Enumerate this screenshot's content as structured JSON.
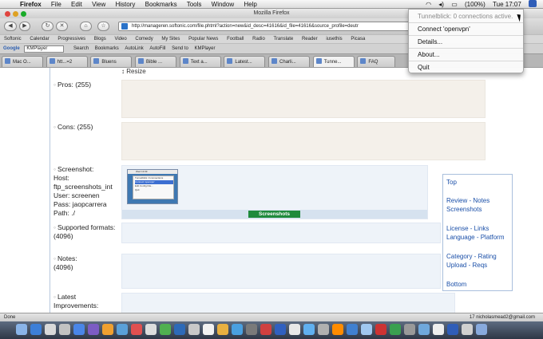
{
  "menubar": {
    "app": "Firefox",
    "menus": [
      "File",
      "Edit",
      "View",
      "History",
      "Bookmarks",
      "Tools",
      "Window",
      "Help"
    ],
    "battery": "(100%)",
    "clock": "Tue 17:07"
  },
  "window": {
    "title": "Mozilla Firefox",
    "url": "http://manageren.softonic.com/file.phtml?action=new&id_desc=41616&id_file=41616&source_profile=deutr"
  },
  "bookmarks": [
    "Softonic",
    "Calendar",
    "Progressives",
    "Blogs",
    "Video",
    "Comedy",
    "My Sites",
    "Popular News",
    "Football",
    "Radio",
    "Translate",
    "Reader",
    "iusethis",
    "Picasa"
  ],
  "googlebar": {
    "logo": "Google",
    "field": "KMPlayer",
    "items": [
      "Search",
      "Bookmarks",
      "AutoLink",
      "AutoFill",
      "Send to",
      "KMPlayer"
    ],
    "settings": "Settings"
  },
  "tabs": [
    "Mac O...",
    "htt...=2",
    "Bluens",
    "Bible ...",
    "Text a...",
    "Latest...",
    "Charli...",
    "Tunne...",
    "FAQ"
  ],
  "page": {
    "resize": "Resize",
    "pros": "Pros: (255)",
    "cons": "Cons: (255)",
    "screenshot_label": "Screenshot:",
    "host": "Host:",
    "host_value": "ftp_screenshots_int",
    "user": "User: screenen",
    "pass": "Pass: jaopcarrera",
    "path": "Path: ./",
    "screenshots_button": "Screenshots",
    "supported_formats": "Supported formats:",
    "supported_count": "(4096)",
    "notes": "Notes:",
    "notes_count": "(4096)",
    "latest": "Latest Improvements:",
    "thumb_clock": "Wed 13:09",
    "thumb_menu": [
      "Tunnelblick: 0 connections",
      "Connect 'openvpn'",
      "Edit Config File...",
      "Quit"
    ]
  },
  "nav_links": {
    "top": "Top",
    "review_notes": "Review - Notes",
    "screenshots": "Screenshots",
    "license_links": "License - Links",
    "language_platform": "Language - Platform",
    "category_rating": "Category - Rating",
    "upload_reqs": "Upload - Reqs",
    "bottom": "Bottom"
  },
  "status": {
    "text": "Done",
    "mail": "17 nicholasmead2@gmail.com"
  },
  "tunnelblick_menu": {
    "status": "Tunnelblick: 0 connections active.",
    "connect": "Connect 'openvpn'",
    "details": "Details...",
    "about": "About...",
    "quit": "Quit"
  },
  "dock_colors": [
    "#8ab4e8",
    "#3d7fd8",
    "#d9d9d9",
    "#c2c2c2",
    "#4a86e8",
    "#7c5cc4",
    "#f0a030",
    "#5aa0d8",
    "#e05050",
    "#ddd",
    "#50b050",
    "#2d6ab8",
    "#c8c8c8",
    "#f2f2f2",
    "#e8b040",
    "#4aa0e0",
    "#7a7a7a",
    "#d04040",
    "#3060c0",
    "#e8e8e8",
    "#60b0f0",
    "#b0b0b0",
    "#ff8c00",
    "#4080d0",
    "#a0c8f0",
    "#cc3333",
    "#3aa050",
    "#999999",
    "#6fa8dc",
    "#eeeeee",
    "#2f5db8",
    "#d0d0d0",
    "#88aadd"
  ]
}
